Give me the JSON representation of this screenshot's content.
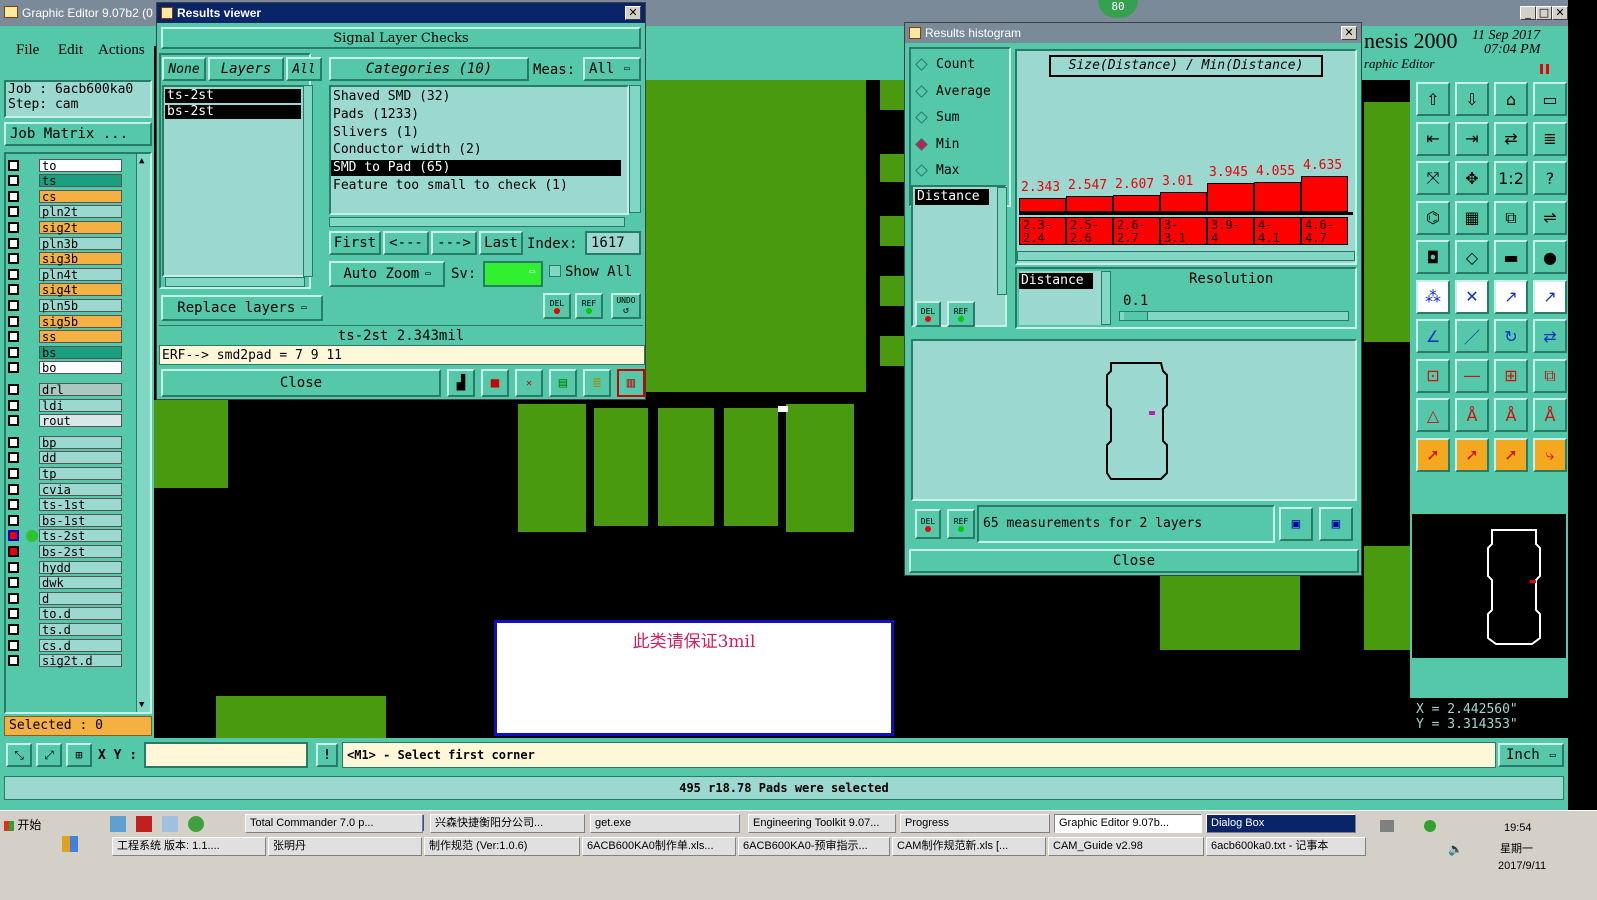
{
  "main": {
    "title": "Graphic Editor 9.07b2 (0",
    "menu": [
      "File",
      "Edit",
      "Actions"
    ],
    "job_label": "Job  : 6acb600ka0",
    "step_label": "Step: cam",
    "job_matrix": "Job Matrix ...",
    "layers": [
      {
        "name": "to",
        "color": "#ffffff"
      },
      {
        "name": "ts",
        "color": "#1aa080"
      },
      {
        "name": "cs",
        "color": "#f4b040"
      },
      {
        "name": "pln2t",
        "color": "#9ad8d0"
      },
      {
        "name": "sig2t",
        "color": "#f4b040"
      },
      {
        "name": "pln3b",
        "color": "#9ad8d0"
      },
      {
        "name": "sig3b",
        "color": "#f4b040"
      },
      {
        "name": "pln4t",
        "color": "#9ad8d0"
      },
      {
        "name": "sig4t",
        "color": "#f4b040"
      },
      {
        "name": "pln5b",
        "color": "#9ad8d0"
      },
      {
        "name": "sig5b",
        "color": "#f4b040"
      },
      {
        "name": "ss",
        "color": "#f4b040"
      },
      {
        "name": "bs",
        "color": "#1aa080"
      },
      {
        "name": "bo",
        "color": "#ffffff"
      },
      {
        "name": "drl",
        "color": "#a8c8c0"
      },
      {
        "name": "ldi",
        "color": "#9ad8d0"
      },
      {
        "name": "rout",
        "color": "#d8e8e8"
      },
      {
        "name": "bp",
        "color": "#9ad8d0"
      },
      {
        "name": "dd",
        "color": "#9ad8d0"
      },
      {
        "name": "tp",
        "color": "#9ad8d0"
      },
      {
        "name": "cvia",
        "color": "#9ad8d0"
      },
      {
        "name": "ts-1st",
        "color": "#9ad8d0"
      },
      {
        "name": "bs-1st",
        "color": "#9ad8d0"
      },
      {
        "name": "ts-2st",
        "color": "#9ad8d0"
      },
      {
        "name": "bs-2st",
        "color": "#9ad8d0"
      },
      {
        "name": "hydd",
        "color": "#9ad8d0"
      },
      {
        "name": "dwk",
        "color": "#9ad8d0"
      },
      {
        "name": "d",
        "color": "#9ad8d0"
      },
      {
        "name": "to.d",
        "color": "#9ad8d0"
      },
      {
        "name": "ts.d",
        "color": "#9ad8d0"
      },
      {
        "name": "cs.d",
        "color": "#9ad8d0"
      },
      {
        "name": "sig2t.d",
        "color": "#9ad8d0"
      }
    ],
    "selected": "Selected : 0",
    "xy_label": "X Y :",
    "prompt": "<M1> - Select first corner",
    "status": "495 r18.78 Pads were selected",
    "coord_x": "X = 2.442560\"",
    "coord_y": "Y = 3.314353\"",
    "units": "Inch",
    "brand": "nesis 2000",
    "brand_sub": "raphic Editor",
    "date": "11 Sep 2017",
    "time": "07:04 PM",
    "badge": "80",
    "note_text": "此类请保证3mil"
  },
  "results_viewer": {
    "title": "Results viewer",
    "header": "Signal Layer Checks",
    "btn_none": "None",
    "btn_layers": "Layers",
    "btn_all": "All",
    "layers_list": [
      "ts-2st",
      "bs-2st"
    ],
    "categories_label": "Categories (10)",
    "meas_label": "Meas:",
    "meas_value": "All",
    "categories": [
      "Shaved SMD (32)",
      "Pads (1233)",
      "Slivers (1)",
      "Conductor width (2)",
      "SMD to Pad (65)",
      "Feature too small to check (1)"
    ],
    "nav": [
      "First",
      "<---",
      "--->",
      "Last"
    ],
    "index_label": "Index:",
    "index_value": "1617",
    "auto_zoom": "Auto Zoom",
    "sv_label": "Sv:",
    "show_all": "Show All",
    "replace_layers": "Replace layers",
    "del": "DEL",
    "ref": "REF",
    "undo": "UNDO",
    "info": "ts-2st 2.343mil",
    "erf": "ERF--> smd2pad = 7 9 11",
    "close": "Close"
  },
  "histogram": {
    "title": "Results histogram",
    "options": [
      "Count",
      "Average",
      "Sum",
      "Min",
      "Max"
    ],
    "selected_option": "Min",
    "distance_label": "Distance",
    "formula": "Size(Distance) / Min(Distance)",
    "values": [
      "2.343",
      "2.547",
      "2.607",
      "3.01",
      "3.945",
      "4.055",
      "4.635"
    ],
    "ranges": [
      "2.3-\n2.4",
      "2.5-\n2.6",
      "2.6-\n2.7",
      "3-\n3.1",
      "3.9-\n4",
      "4-\n4.1",
      "4.6-\n4.7"
    ],
    "distance2": "Distance",
    "resolution_label": "Resolution",
    "resolution_value": "0.1",
    "measurements": "65 measurements for 2 layers",
    "del": "DEL",
    "ref": "REF",
    "close": "Close"
  },
  "taskbar": {
    "start": "开始",
    "row1": [
      "Total Commander 7.0 p...",
      "兴森快捷衡阳分公司...",
      "get.exe",
      "Engineering Toolkit 9.07...",
      "Progress",
      "Graphic Editor 9.07b...",
      "Dialog Box"
    ],
    "row2": [
      "工程系统  版本: 1.1....",
      "张明丹",
      "制作规范 (Ver:1.0.6)",
      "6ACB600KA0制作单.xls...",
      "6ACB600KA0-预审指示...",
      "CAM制作规范新.xls [...",
      "CAM_Guide v2.98",
      "6acb600ka0.txt - 记事本"
    ],
    "clock": "19:54",
    "weekday": "星期一",
    "date": "2017/9/11"
  }
}
